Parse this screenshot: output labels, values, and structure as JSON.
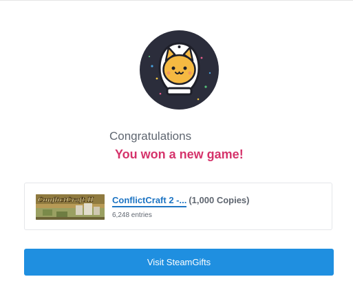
{
  "header": {
    "congrats_text": "Congratulations",
    "win_text": "You won a new game!"
  },
  "avatar": {
    "icon": "astronaut-cat-icon"
  },
  "giveaway": {
    "thumbnail_text": "ConflictCraft II",
    "title": "ConflictCraft 2 -...",
    "copies": "(1,000 Copies)",
    "entries": "6,248 entries"
  },
  "action": {
    "button_label": "Visit SteamGifts"
  },
  "colors": {
    "accent": "#d5336b",
    "link": "#1d74c3",
    "button": "#1f8fe0",
    "avatar_bg": "#2b2d3b"
  }
}
